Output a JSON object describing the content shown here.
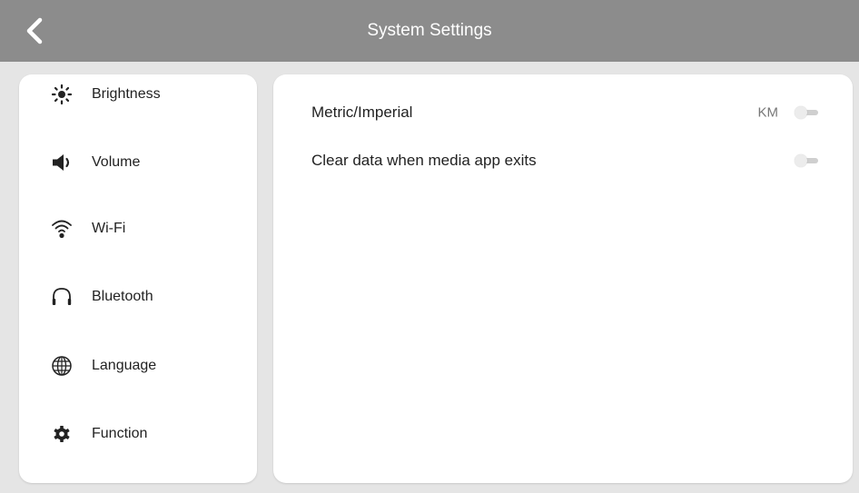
{
  "header": {
    "title": "System Settings",
    "back_icon": "chevron-left-icon"
  },
  "sidebar": {
    "items": [
      {
        "label": "Brightness",
        "icon": "brightness-icon"
      },
      {
        "label": "Volume",
        "icon": "volume-icon"
      },
      {
        "label": "Wi-Fi",
        "icon": "wifi-icon"
      },
      {
        "label": "Bluetooth",
        "icon": "headphones-icon"
      },
      {
        "label": "Language",
        "icon": "globe-icon"
      },
      {
        "label": "Function",
        "icon": "gear-icon"
      }
    ]
  },
  "panel": {
    "rows": [
      {
        "label": "Metric/Imperial",
        "value": "KM",
        "toggle_on": false
      },
      {
        "label": "Clear data when media app exits",
        "toggle_on": false
      }
    ]
  },
  "colors": {
    "header_bg": "#8c8c8c",
    "page_bg": "#e5e5e5",
    "card_bg": "#ffffff"
  }
}
